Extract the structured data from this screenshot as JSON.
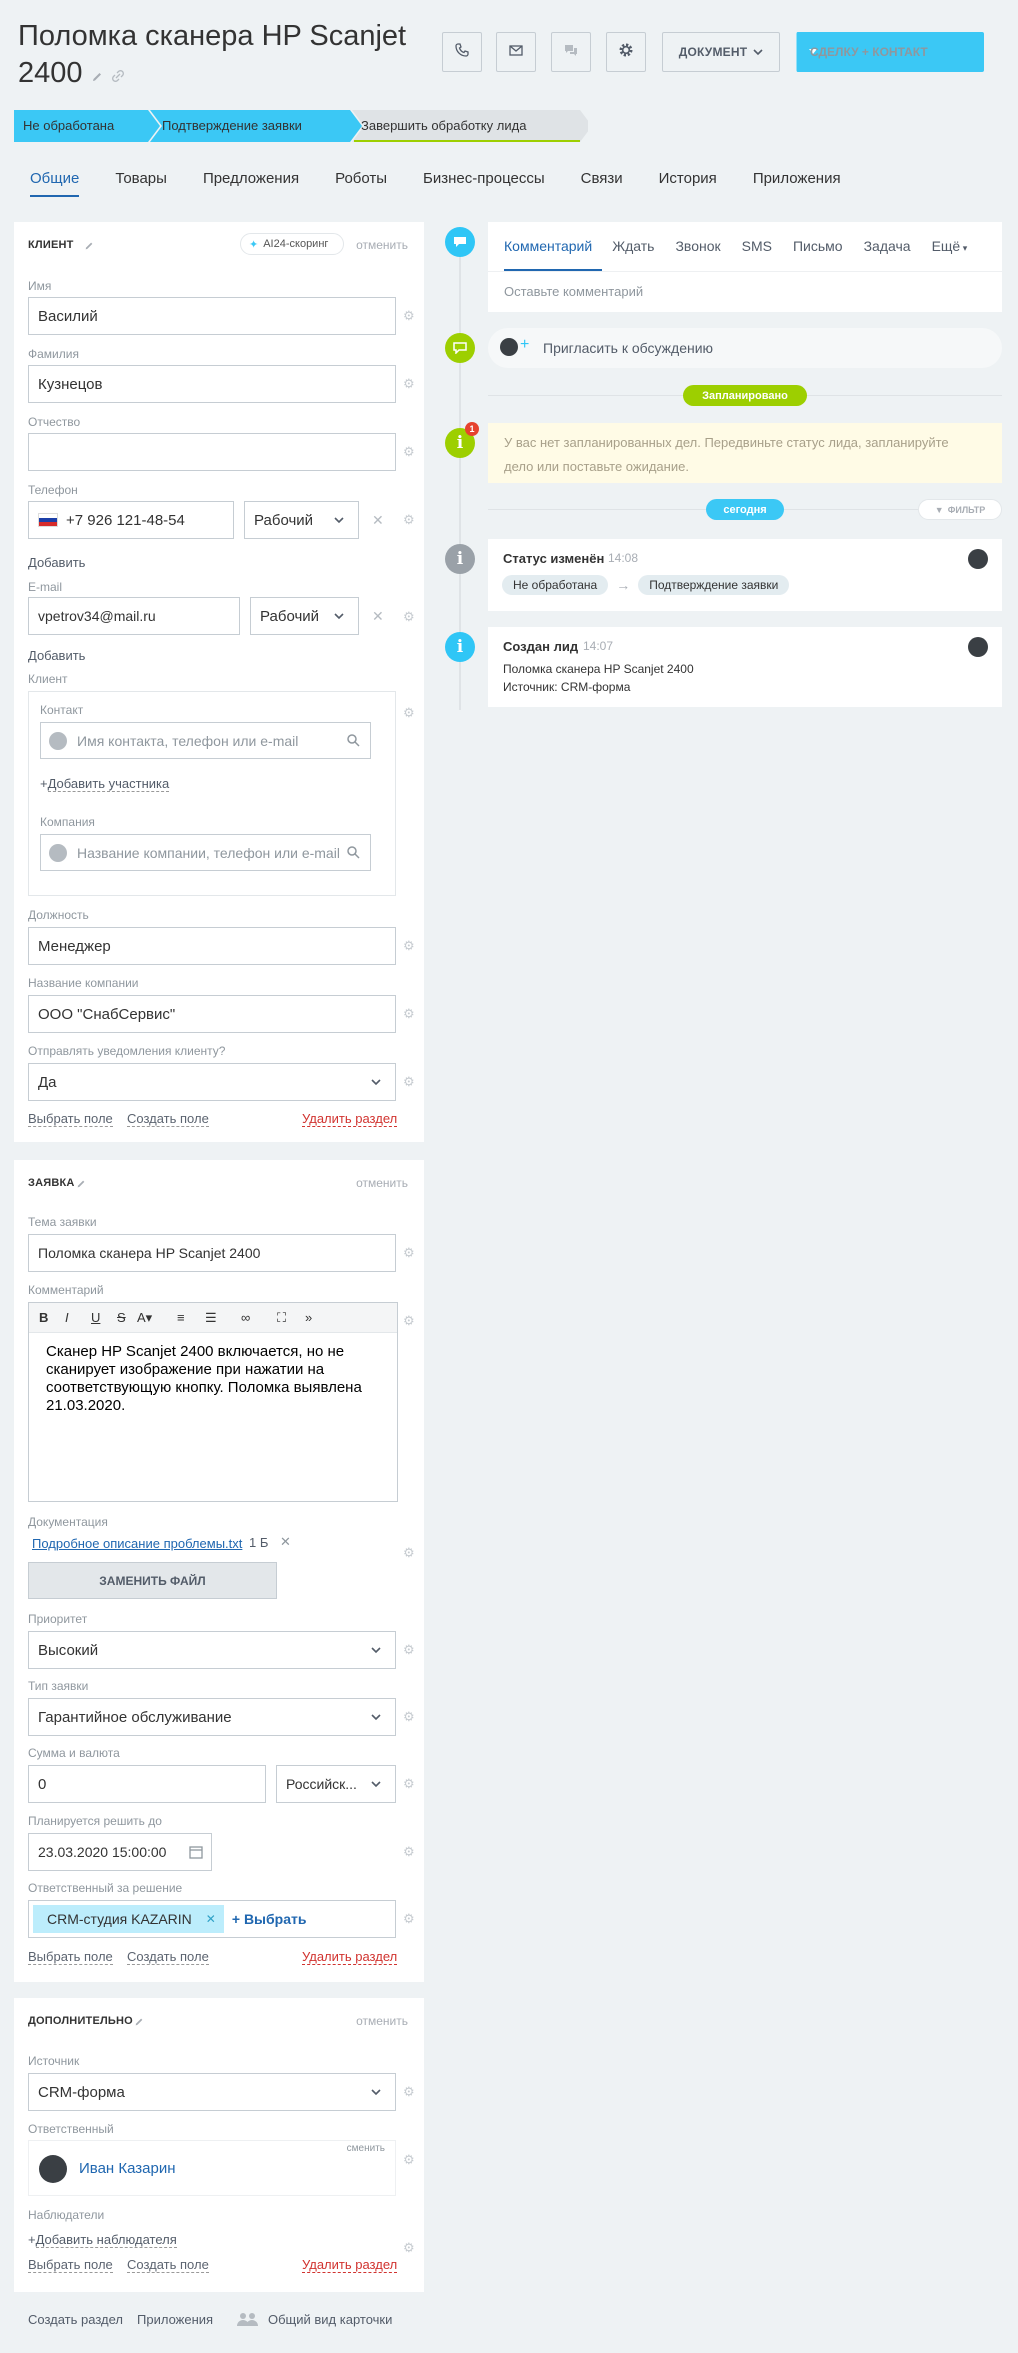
{
  "header": {
    "title": "Поломка сканера HP Scanjet 2400",
    "doc_button": "ДОКУМЕНТ",
    "main_button": "СДЕЛКУ + КОНТАКТ"
  },
  "stages": [
    "Не обработана",
    "Подтверждение заявки",
    "Завершить обработку лида"
  ],
  "tabs": [
    "Общие",
    "Товары",
    "Предложения",
    "Роботы",
    "Бизнес-процессы",
    "Связи",
    "История",
    "Приложения"
  ],
  "client": {
    "title": "КЛИЕНТ",
    "scoring": "AI24-скоринг",
    "cancel": "отменить",
    "name_label": "Имя",
    "name": "Василий",
    "surname_label": "Фамилия",
    "surname": "Кузнецов",
    "patronymic_label": "Отчество",
    "patronymic": "",
    "phone_label": "Телефон",
    "phone": "+7 926 121-48-54",
    "phone_type": "Рабочий",
    "add": "Добавить",
    "email_label": "E-mail",
    "email": "vpetrov34@mail.ru",
    "email_type": "Рабочий",
    "client_label": "Клиент",
    "contact_label": "Контакт",
    "contact_placeholder": "Имя контакта, телефон или e-mail",
    "add_participant": "Добавить участника",
    "company_label": "Компания",
    "company_placeholder": "Название компании, телефон или e-mail",
    "position_label": "Должность",
    "position": "Менеджер",
    "company_name_label": "Название компании",
    "company_name": "ООО \"СнабСервис\"",
    "notify_label": "Отправлять уведомления клиенту?",
    "notify": "Да",
    "select_field": "Выбрать поле",
    "create_field": "Создать поле",
    "delete_section": "Удалить раздел"
  },
  "request": {
    "title": "ЗАЯВКА",
    "cancel": "отменить",
    "topic_label": "Тема заявки",
    "topic": "Поломка сканера HP Scanjet 2400",
    "comment_label": "Комментарий",
    "comment": "Сканер HP Scanjet 2400 включается, но не сканирует изображение при нажатии на соответствующую кнопку. Поломка выявлена 21.03.2020.",
    "doc_label": "Документация",
    "doc_file": "Подробное описание проблемы.txt",
    "doc_size": "1 Б",
    "replace_file": "ЗАМЕНИТЬ ФАЙЛ",
    "priority_label": "Приоритет",
    "priority": "Высокий",
    "type_label": "Тип заявки",
    "type": "Гарантийное обслуживание",
    "sum_label": "Сумма и валюта",
    "sum": "0",
    "currency": "Российск...",
    "deadline_label": "Планируется решить до",
    "deadline": "23.03.2020 15:00:00",
    "resp_label": "Ответственный за решение",
    "resp": "CRM-студия KAZARIN",
    "choose": "Выбрать",
    "select_field": "Выбрать поле",
    "create_field": "Создать поле",
    "delete_section": "Удалить раздел"
  },
  "extra": {
    "title": "ДОПОЛНИТЕЛЬНО",
    "cancel": "отменить",
    "source_label": "Источник",
    "source": "CRM-форма",
    "resp_label": "Ответственный",
    "change": "сменить",
    "resp": "Иван Казарин",
    "observers_label": "Наблюдатели",
    "add_observer": "Добавить наблюдателя",
    "select_field": "Выбрать поле",
    "create_field": "Создать поле",
    "delete_section": "Удалить раздел"
  },
  "footer": {
    "create_section": "Создать раздел",
    "apps": "Приложения",
    "card_view": "Общий вид карточки"
  },
  "timeline": {
    "tabs": [
      "Комментарий",
      "Ждать",
      "Звонок",
      "SMS",
      "Письмо",
      "Задача",
      "Ещё"
    ],
    "comment_placeholder": "Оставьте комментарий",
    "invite": "Пригласить к обсуждению",
    "planned": "Запланировано",
    "warning_badge": "1",
    "warning": "У вас нет запланированных дел. Передвиньте статус лида, запланируйте дело или поставьте ожидание.",
    "today": "сегодня",
    "filter": "ФИЛЬТР",
    "ev1_title": "Статус изменён",
    "ev1_time": "14:08",
    "ev1_from": "Не обработана",
    "ev1_to": "Подтверждение заявки",
    "ev2_title": "Создан лид",
    "ev2_time": "14:07",
    "ev2_line1": "Поломка сканера HP Scanjet 2400",
    "ev2_line2": "Источник: CRM-форма"
  },
  "colors": {
    "accent": "#3bc8f5",
    "link": "#2067b0",
    "green": "#9dcf00",
    "danger": "#d1332f",
    "warning_bg": "#fffbe6"
  }
}
